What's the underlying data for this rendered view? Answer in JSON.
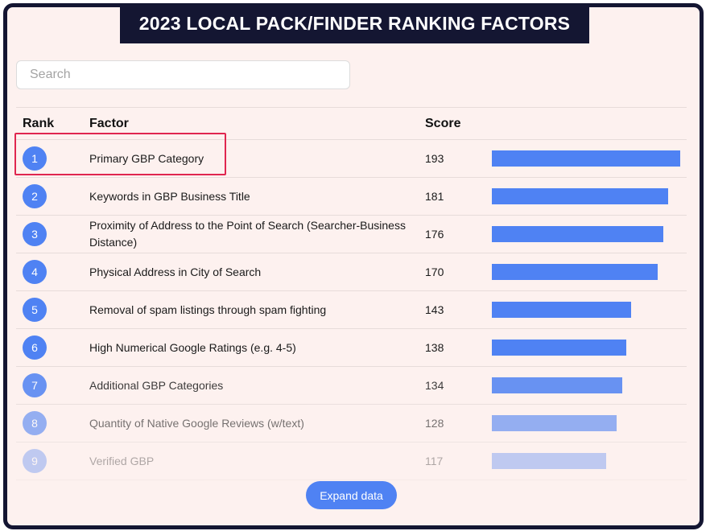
{
  "title": "2023 LOCAL PACK/FINDER RANKING FACTORS",
  "search": {
    "placeholder": "Search",
    "value": ""
  },
  "table": {
    "headers": {
      "rank": "Rank",
      "factor": "Factor",
      "score": "Score"
    },
    "max_score": 193,
    "rows": [
      {
        "rank": "1",
        "factor": "Primary GBP Category",
        "score": "193",
        "value": 193
      },
      {
        "rank": "2",
        "factor": "Keywords in GBP Business Title",
        "score": "181",
        "value": 181
      },
      {
        "rank": "3",
        "factor": "Proximity of Address to the Point of Search (Searcher-Business Distance)",
        "score": "176",
        "value": 176
      },
      {
        "rank": "4",
        "factor": "Physical Address in City of Search",
        "score": "170",
        "value": 170
      },
      {
        "rank": "5",
        "factor": "Removal of spam listings through spam fighting",
        "score": "143",
        "value": 143
      },
      {
        "rank": "6",
        "factor": "High Numerical Google Ratings (e.g. 4-5)",
        "score": "138",
        "value": 138
      },
      {
        "rank": "7",
        "factor": "Additional GBP Categories",
        "score": "134",
        "value": 134
      },
      {
        "rank": "8",
        "factor": "Quantity of Native Google Reviews (w/text)",
        "score": "128",
        "value": 128
      },
      {
        "rank": "9",
        "factor": "Verified GBP",
        "score": "117",
        "value": 117
      }
    ]
  },
  "expand_button": {
    "label": "Expand data"
  },
  "colors": {
    "accent": "#4f82f3",
    "title_bg": "#141632",
    "panel_bg": "#fdf1ef",
    "highlight": "#e0264f"
  }
}
